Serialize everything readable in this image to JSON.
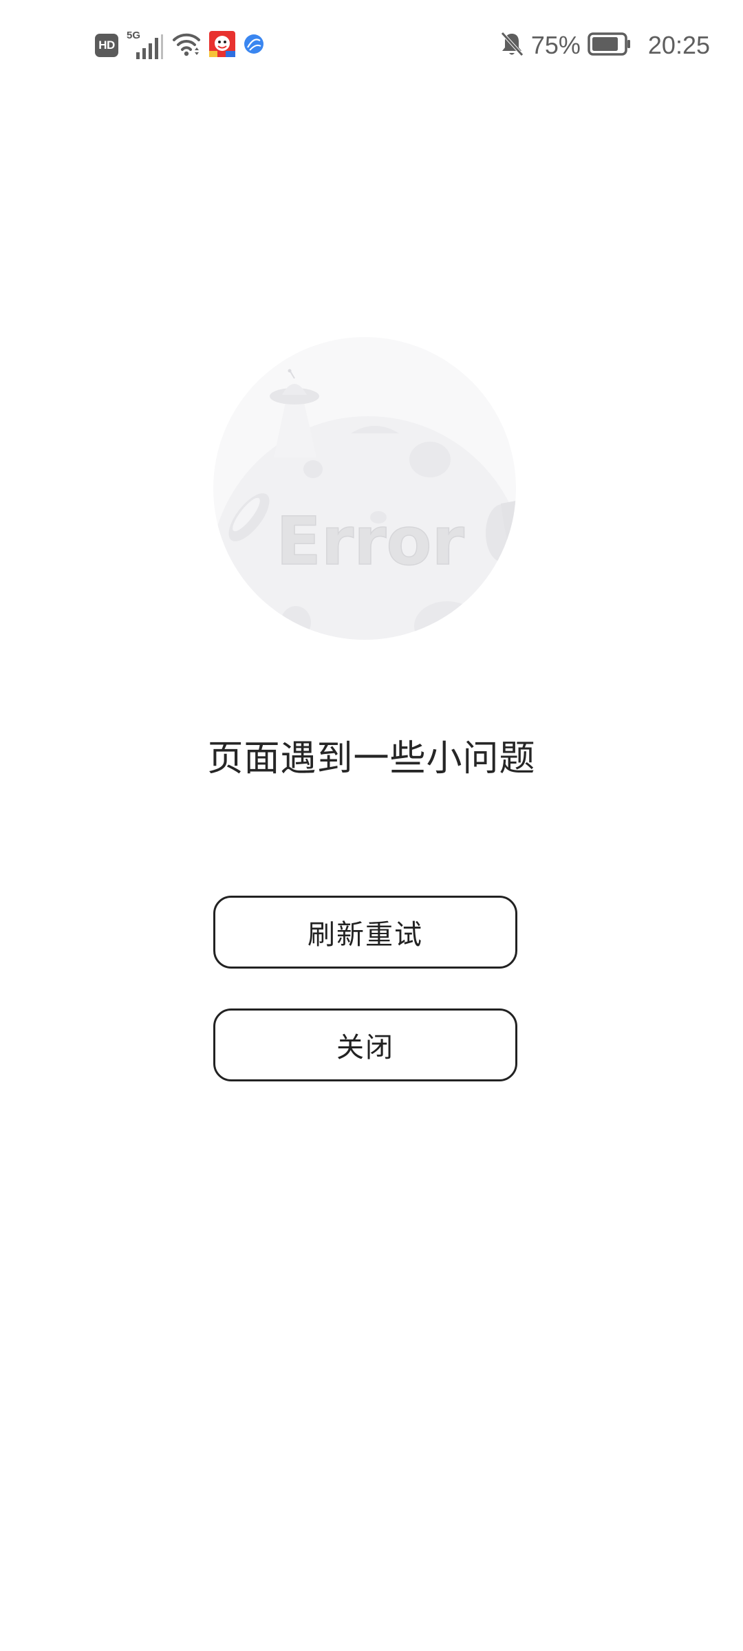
{
  "status_bar": {
    "hd_badge": "HD",
    "network_type": "5G",
    "battery_percent": "75%",
    "time": "20:25",
    "icons": [
      "hd-icon",
      "signal-icon",
      "wifi-icon",
      "app-notification-icon",
      "browser-icon",
      "mute-icon",
      "battery-icon"
    ]
  },
  "illustration": {
    "text": "Error"
  },
  "message": "页面遇到一些小问题",
  "buttons": {
    "refresh_label": "刷新重试",
    "close_label": "关闭"
  },
  "colors": {
    "background": "#ffffff",
    "text": "#222222",
    "button_border": "#222222",
    "illustration": "#f4f4f5",
    "status_icons": "#5e5e5e",
    "browser_icon": "#3a86f0"
  }
}
